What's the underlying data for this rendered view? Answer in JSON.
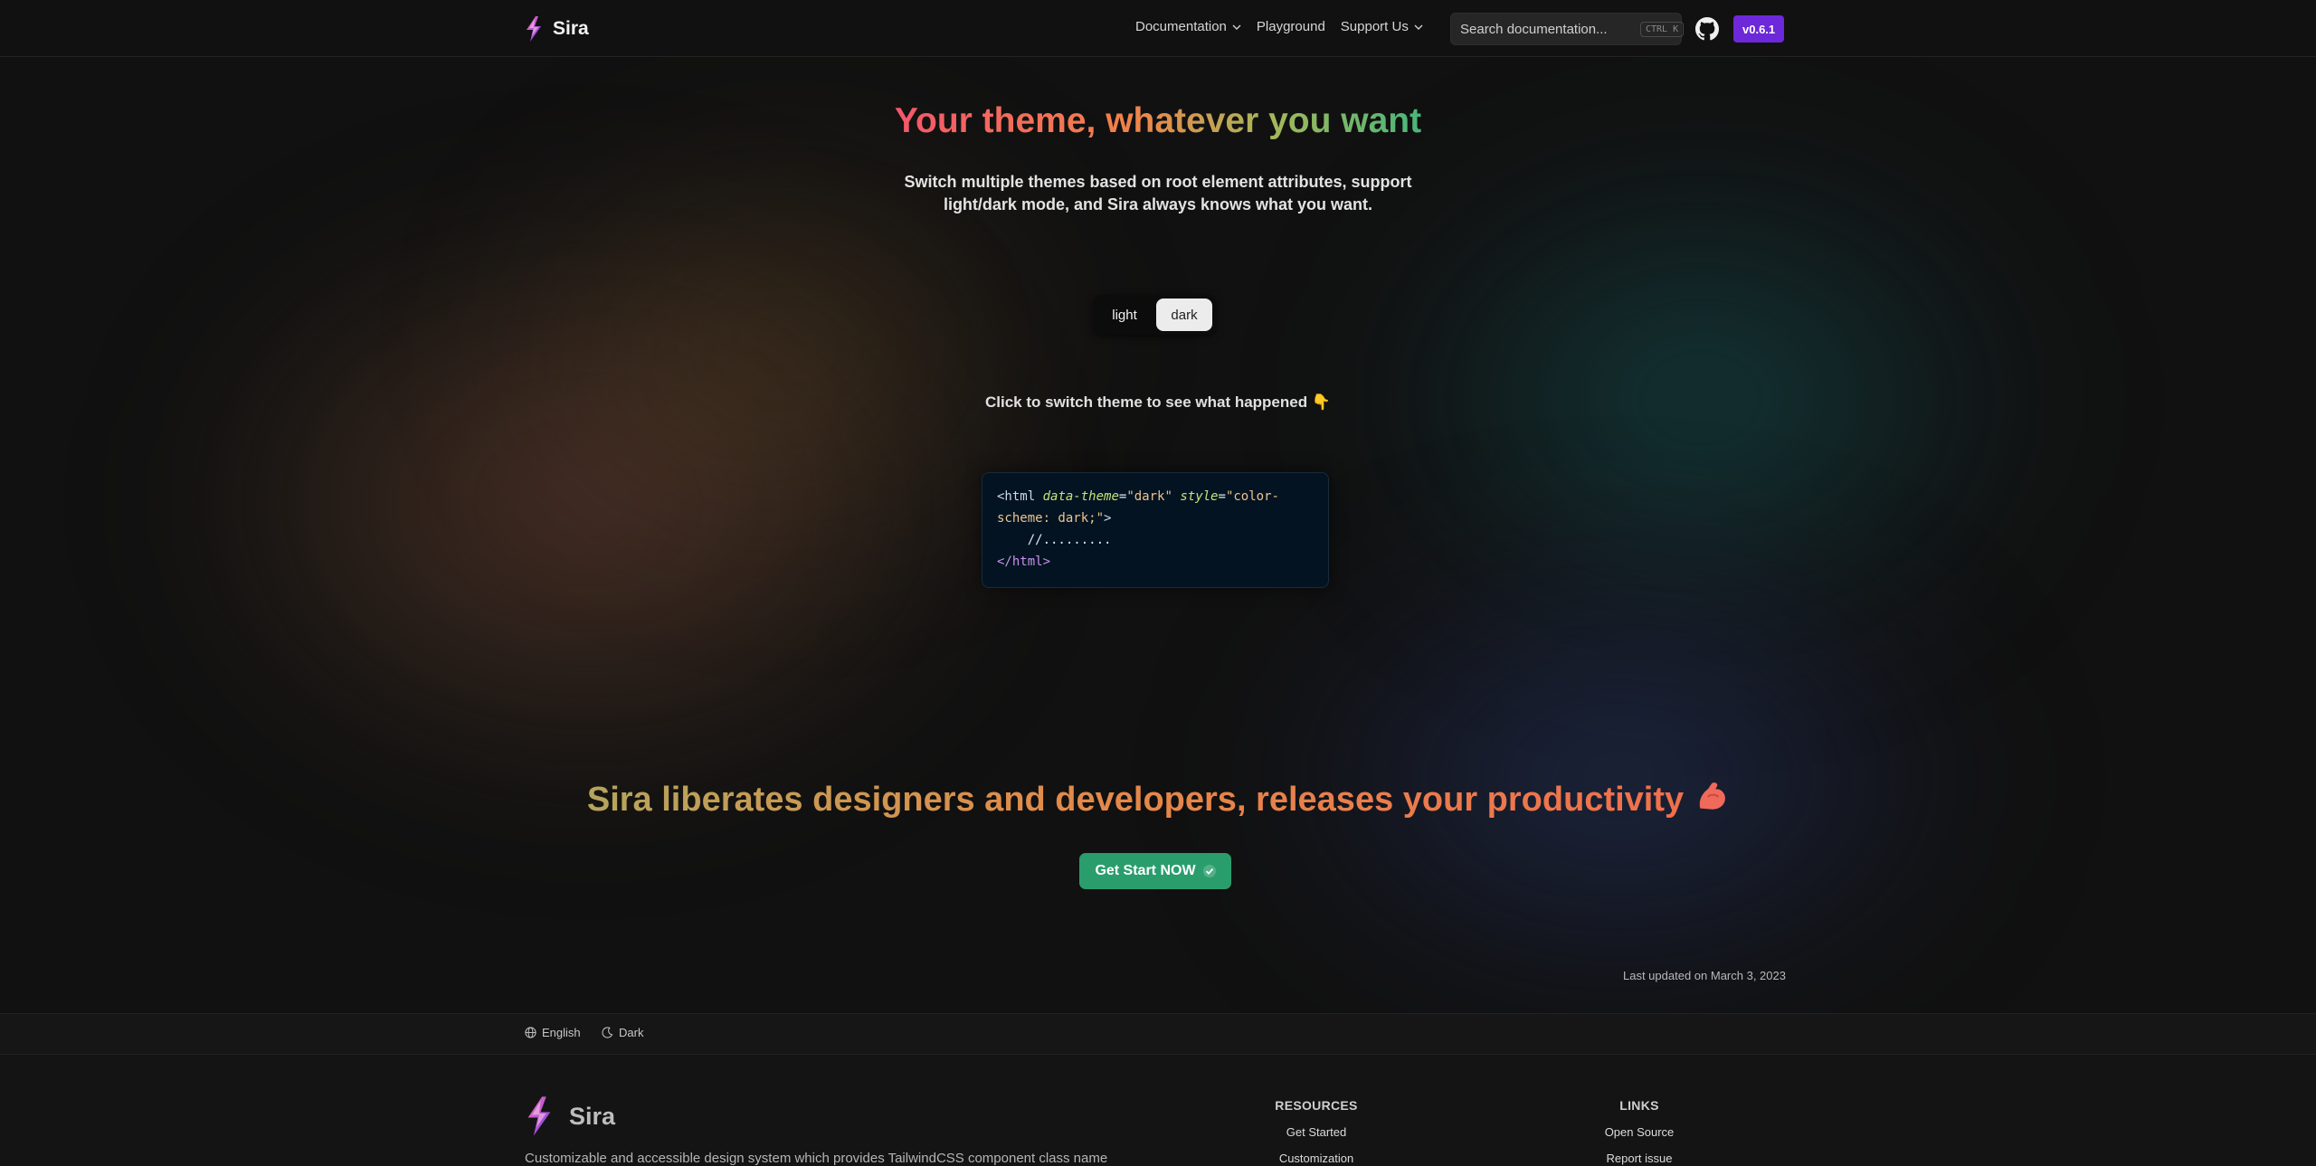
{
  "header": {
    "brand_name": "Sira",
    "nav": {
      "documentation": "Documentation",
      "playground": "Playground",
      "support_us": "Support Us"
    },
    "search": {
      "placeholder": "Search documentation...",
      "shortcut": "CTRL K"
    },
    "version": "v0.6.1",
    "icons": [
      "sira-logo-icon",
      "chevron-down-icon",
      "github-icon"
    ]
  },
  "hero": {
    "title": "Your theme, whatever you want",
    "subtitle": "Switch multiple themes based on root element attributes, support light/dark mode, and Sira always knows what you want.",
    "theme_toggle": {
      "options": [
        "light",
        "dark"
      ],
      "selected": "dark"
    },
    "hint": "Click to switch theme to see what happened 👇",
    "code": {
      "open_tag": "<html",
      "attr1": "data-theme",
      "val1": "\"dark\"",
      "attr2": "style",
      "val2": "\"color-",
      "val2_cont": "scheme: dark;\"",
      "open_end": ">",
      "body": "//.........",
      "close_tag": "</html>"
    }
  },
  "cta": {
    "title": "Sira liberates designers and developers, releases your productivity",
    "button": "Get Start NOW"
  },
  "last_updated": "Last updated on March 3, 2023",
  "subbar": {
    "language": "English",
    "theme": "Dark"
  },
  "footer": {
    "brand_name": "Sira",
    "description": "Customizable and accessible design system which provides TailwindCSS component class name",
    "resources": {
      "heading": "RESOURCES",
      "items": [
        "Get Started",
        "Customization"
      ]
    },
    "links": {
      "heading": "LINKS",
      "items": [
        "Open Source",
        "Report issue"
      ]
    }
  },
  "colors": {
    "background": "#111111",
    "version_badge": "#6d28d9",
    "cta_button": "#2a9d6c",
    "code_bg": "#041322"
  }
}
